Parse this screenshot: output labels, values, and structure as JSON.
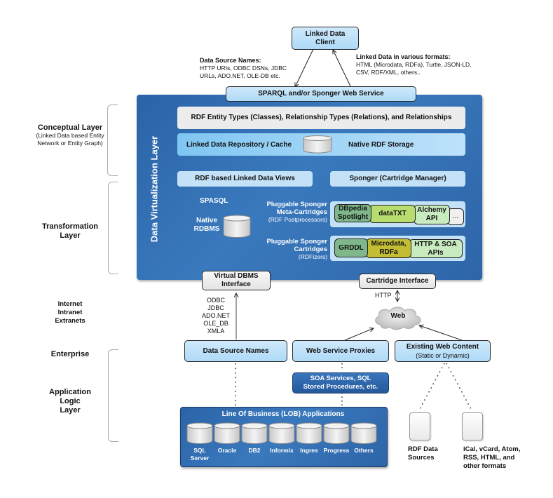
{
  "top": {
    "client": "Linked Data\nClient",
    "left_note_title": "Data Source Names:",
    "left_note_body": "HTTP URIs, ODBC DSNs, JDBC\nURLs, ADO.NET, OLE-DB etc.",
    "right_note_title": "Linked Data in various formats:",
    "right_note_body": "HTML (Microdata, RDFa), Turtle, JSON-LD,\nCSV, RDF/XML, others..",
    "sparql_service": "SPARQL and/or Sponger Web Service"
  },
  "left_labels": {
    "conceptual_title": "Conceptual Layer",
    "conceptual_sub": "(Linked Data based Entity\nNetwork or Entity Graph)",
    "transformation": "Transformation\nLayer",
    "networks": "Internet\nIntranet\nExtranets",
    "enterprise": "Enterprise",
    "app_logic": "Application\nLogic\nLayer"
  },
  "dvl": {
    "title": "Data Virtualization Layer",
    "entity_types": "RDF Entity Types (Classes), Relationship Types (Relations), and Relationships",
    "repo": "Linked Data Repository / Cache",
    "native_rdf": "Native RDF Storage",
    "views": "RDF based Linked Data Views",
    "sponger": "Sponger (Cartridge Manager)",
    "spasql": "SPASQL",
    "native_rdbms": "Native\nRDBMS",
    "meta_title": "Pluggable Sponger\nMeta-Cartridges",
    "meta_sub": "(RDF Postprocessors)",
    "cart_title": "Pluggable Sponger\nCartridges",
    "cart_sub": "(RDFizers)",
    "meta_cartridges": [
      "DBpedia\nSpotlight",
      "dataTXT",
      "Alchemy\nAPI",
      "..."
    ],
    "cartridges": [
      "GRDDL",
      "Microdata,\nRDFa",
      "HTTP & SOA\nAPIs"
    ]
  },
  "interfaces": {
    "virtual_dbms": "Virtual DBMS\nInterface",
    "cartridge": "Cartridge Interface",
    "protocols": "ODBC\nJDBC\nADO.NET\nOLE_DB\nXMLA",
    "http": "HTTP",
    "web": "Web"
  },
  "enterprise": {
    "dsn": "Data Source Names",
    "proxies": "Web Service Proxies",
    "existing_title": "Existing Web Content",
    "existing_sub": "(Static or Dynamic)",
    "soa": "SOA Services, SQL\nStored Procedures, etc.",
    "lob_title": "Line Of Business (LOB) Applications",
    "lob_dbs": [
      "SQL\nServer",
      "Oracle",
      "DB2",
      "Informix",
      "Ingres",
      "Progress",
      "Others"
    ],
    "rdf_sources": "RDF Data\nSources",
    "other_formats": "iCal, vCard, Atom,\nRSS, HTML, and\nother formats"
  },
  "colors": {
    "panel_blue": "#2f6aae",
    "light_blue": "#b9e0f8",
    "meta_green": "#7fb78a",
    "datatxt_green": "#b8dc6e",
    "alchemy_green": "#c9ebc0",
    "microdata_olive": "#c2bd35"
  }
}
